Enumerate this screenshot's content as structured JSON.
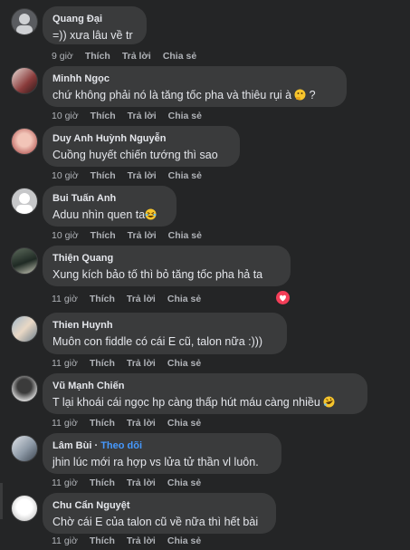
{
  "actions": {
    "like": "Thích",
    "reply": "Trả lời",
    "share": "Chia sẻ"
  },
  "comments": [
    {
      "name": "Quang Đại",
      "text": "=)) xưa lâu về tr",
      "time": "9 giờ",
      "emoji": ""
    },
    {
      "name": "Minhh Ngọc",
      "text": "chứ không phải nó là tăng tốc pha và thiêu rụi à",
      "time": "10 giờ",
      "emoji": "thinking-emoji",
      "suffix": "?"
    },
    {
      "name": "Duy Anh Huỳnh Nguyễn",
      "text": "Cuồng huyết chiến tướng thì sao",
      "time": "10 giờ",
      "emoji": ""
    },
    {
      "name": "Bui Tuấn Anh",
      "text": "Aduu nhìn quen ta",
      "time": "10 giờ",
      "emoji": "laughing-emoji"
    },
    {
      "name": "Thiện Quang",
      "text": "Xung kích bảo tố thì bỏ tăng tốc pha hả ta",
      "time": "11 giờ",
      "emoji": "",
      "reaction": "heart-reaction"
    },
    {
      "name": "Thien Huynh",
      "text": "Muôn con fiddle có cái E cũ, talon nữa :)))",
      "time": "11 giờ",
      "emoji": ""
    },
    {
      "name": "Vũ Mạnh Chiến",
      "text": "T lại khoái cái ngọc hp càng thấp hút máu càng nhiều",
      "time": "11 giờ",
      "emoji": "rofl-emoji"
    },
    {
      "name": "Lâm Bùi",
      "follow": "Theo dõi",
      "text": "jhin lúc mới ra hợp vs lửa tử thần vl luôn.",
      "time": "11 giờ",
      "emoji": ""
    },
    {
      "name": "Chu Cẩn Nguyệt",
      "text": "Chờ cái E của talon cũ về nữa thì hết bài",
      "time": "11 giờ",
      "emoji": ""
    }
  ],
  "colors": {
    "background": "#242526",
    "bubble": "#3a3b3c",
    "text": "#e4e6eb",
    "meta": "#b0b3b8",
    "link": "#4599ff",
    "heart": "#f33e58"
  }
}
